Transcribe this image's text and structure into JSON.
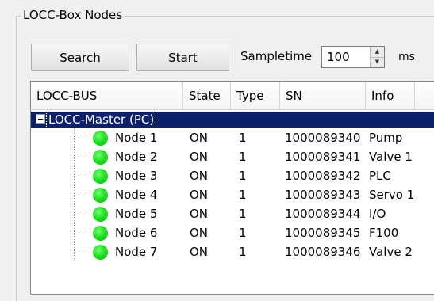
{
  "group": {
    "title": "LOCC-Box Nodes"
  },
  "toolbar": {
    "search_label": "Search",
    "start_label": "Start",
    "sampletime_label": "Sampletime",
    "sampletime_value": "100",
    "unit_label": "ms"
  },
  "tree": {
    "columns": [
      "LOCC-BUS",
      "State",
      "Type",
      "SN",
      "Info"
    ],
    "master": "LOCC-Master (PC)",
    "nodes": [
      {
        "name": "Node 1",
        "state": "ON",
        "type": "1",
        "sn": "1000089340",
        "info": "Pump"
      },
      {
        "name": "Node 2",
        "state": "ON",
        "type": "1",
        "sn": "1000089341",
        "info": "Valve 1"
      },
      {
        "name": "Node 3",
        "state": "ON",
        "type": "1",
        "sn": "1000089342",
        "info": "PLC"
      },
      {
        "name": "Node 4",
        "state": "ON",
        "type": "1",
        "sn": "1000089343",
        "info": "Servo 1"
      },
      {
        "name": "Node 5",
        "state": "ON",
        "type": "1",
        "sn": "1000089344",
        "info": "I/O"
      },
      {
        "name": "Node 6",
        "state": "ON",
        "type": "1",
        "sn": "1000089345",
        "info": "F100"
      },
      {
        "name": "Node 7",
        "state": "ON",
        "type": "1",
        "sn": "1000089346",
        "info": "Valve 2"
      }
    ]
  },
  "colors": {
    "status_on": "#17d917",
    "selection": "#0c216b"
  }
}
